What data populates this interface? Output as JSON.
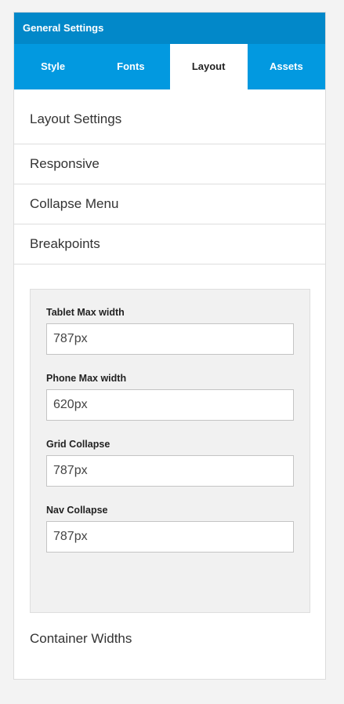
{
  "header": {
    "title": "General Settings"
  },
  "tabs": [
    {
      "label": "Style"
    },
    {
      "label": "Fonts"
    },
    {
      "label": "Layout"
    },
    {
      "label": "Assets"
    }
  ],
  "active_tab": "Layout",
  "sections": [
    {
      "label": "Layout Settings"
    },
    {
      "label": "Responsive"
    },
    {
      "label": "Collapse Menu"
    },
    {
      "label": "Breakpoints"
    }
  ],
  "breakpoints": {
    "fields": [
      {
        "label": "Tablet Max width",
        "value": "787px"
      },
      {
        "label": "Phone Max width",
        "value": "620px"
      },
      {
        "label": "Grid Collapse",
        "value": "787px"
      },
      {
        "label": "Nav Collapse",
        "value": "787px"
      }
    ]
  },
  "footer_section": {
    "label": "Container Widths"
  },
  "colors": {
    "header": "#0288c9",
    "tabs": "#0299e0"
  }
}
